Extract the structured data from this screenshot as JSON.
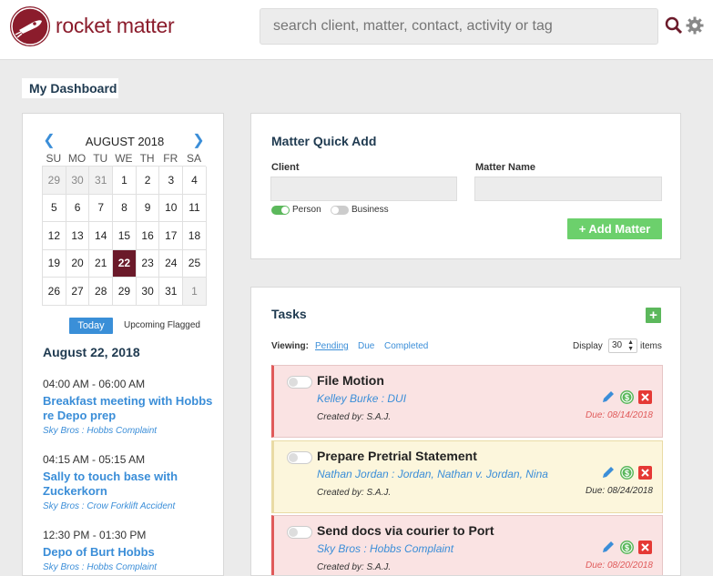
{
  "header": {
    "logo_text": "rocket matter",
    "search_placeholder": "search client, matter, contact, activity or tag"
  },
  "dashboard_tab": "My Dashboard",
  "calendar": {
    "month_label": "AUGUST 2018",
    "day_headers": [
      "SU",
      "MO",
      "TU",
      "WE",
      "TH",
      "FR",
      "SA"
    ],
    "weeks": [
      [
        "29",
        "30",
        "31",
        "1",
        "2",
        "3",
        "4"
      ],
      [
        "5",
        "6",
        "7",
        "8",
        "9",
        "10",
        "11"
      ],
      [
        "12",
        "13",
        "14",
        "15",
        "16",
        "17",
        "18"
      ],
      [
        "19",
        "20",
        "21",
        "22",
        "23",
        "24",
        "25"
      ],
      [
        "26",
        "27",
        "28",
        "29",
        "30",
        "31",
        "1"
      ]
    ],
    "today_button": "Today",
    "upcoming_flagged": "Upcoming Flagged",
    "selected_date": "August 22, 2018",
    "events": [
      {
        "time": "04:00 AM - 06:00 AM",
        "title": "Breakfast meeting with Hobbs re Depo prep",
        "matter": "Sky Bros : Hobbs Complaint"
      },
      {
        "time": "04:15 AM - 05:15 AM",
        "title": "Sally to touch base with Zuckerkorn",
        "matter": "Sky Bros : Crow Forklift Accident"
      },
      {
        "time": "12:30 PM - 01:30 PM",
        "title": "Depo of Burt Hobbs",
        "matter": "Sky Bros : Hobbs Complaint"
      }
    ]
  },
  "matter_quick_add": {
    "title": "Matter Quick Add",
    "client_label": "Client",
    "matter_name_label": "Matter Name",
    "person_label": "Person",
    "business_label": "Business",
    "add_button": "+ Add Matter"
  },
  "tasks": {
    "title": "Tasks",
    "add_button": "+",
    "viewing_label": "Viewing:",
    "filters": [
      "Pending",
      "Due",
      "Completed"
    ],
    "display_label": "Display",
    "display_value": "30",
    "items_label": "items",
    "list": [
      {
        "name": "File Motion",
        "matter": "Kelley Burke : DUI",
        "created_by": "Created by: S.A.J.",
        "due": "Due: 08/14/2018",
        "status": "overdue"
      },
      {
        "name": "Prepare Pretrial Statement",
        "matter": "Nathan Jordan : Jordan, Nathan v. Jordan, Nina",
        "created_by": "Created by: S.A.J.",
        "due": "Due: 08/24/2018",
        "status": "upcoming"
      },
      {
        "name": "Send docs via courier to Port",
        "matter": "Sky Bros : Hobbs Complaint",
        "created_by": "Created by: S.A.J.",
        "due": "Due: 08/20/2018",
        "status": "overdue"
      }
    ]
  },
  "colors": {
    "brand": "#8b1c2c",
    "link": "#3b8ed8",
    "green": "#5cb85c",
    "overdue_bg": "#fae3e3",
    "upcoming_bg": "#fcf6dc"
  }
}
